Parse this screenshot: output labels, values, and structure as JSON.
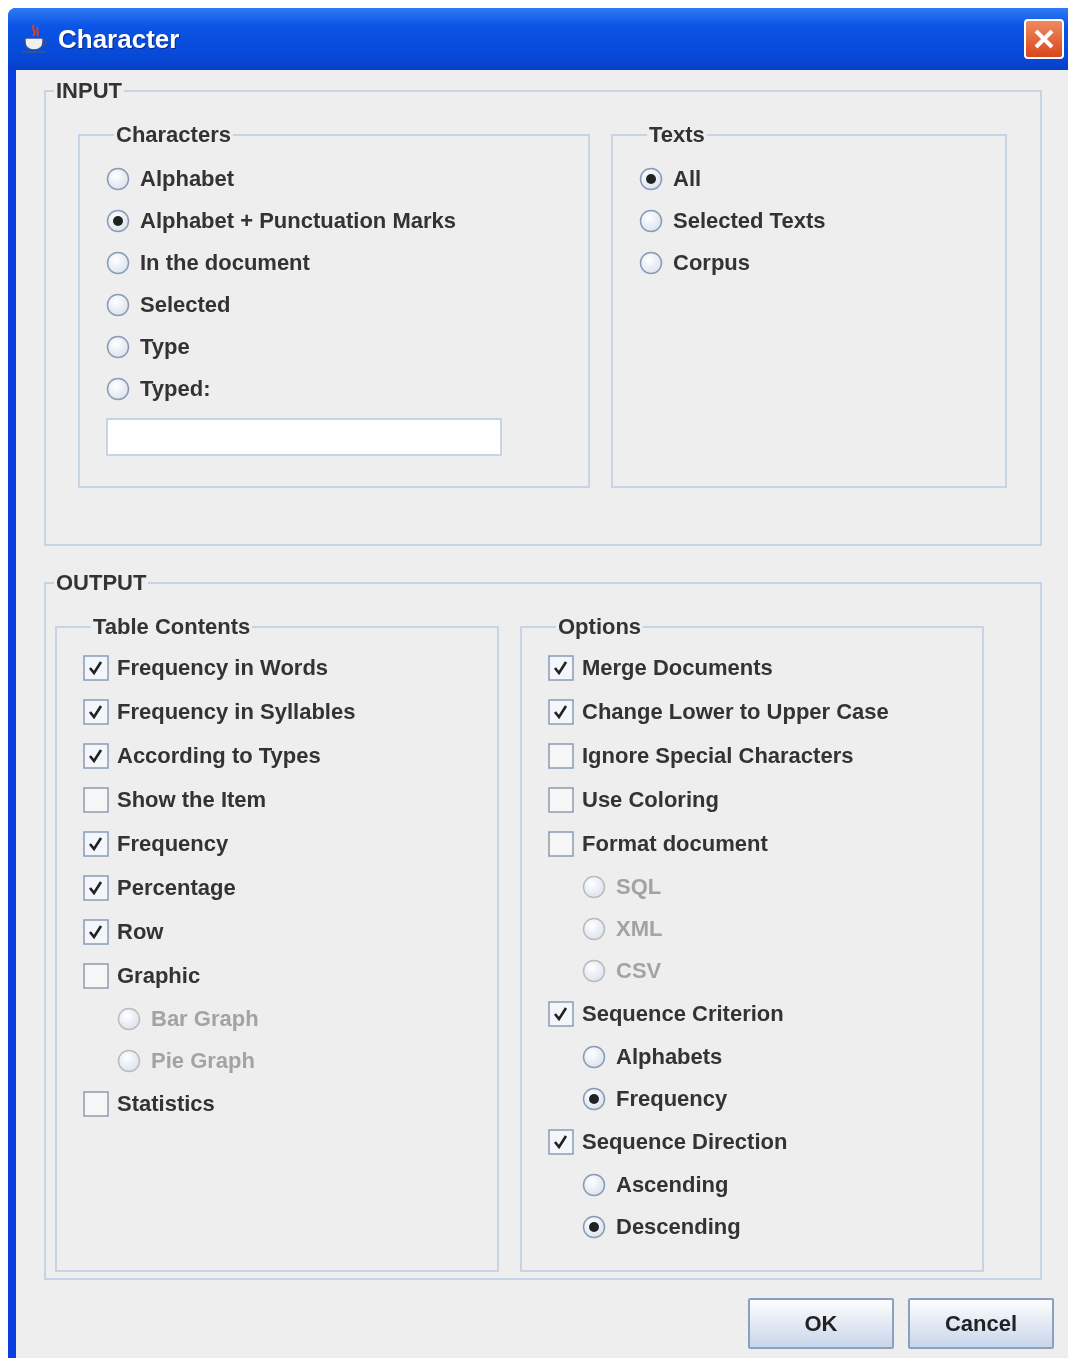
{
  "window": {
    "title": "Character"
  },
  "input": {
    "title": "INPUT",
    "characters": {
      "title": "Characters",
      "items": [
        {
          "kind": "radio",
          "label": "Alphabet",
          "selected": false
        },
        {
          "kind": "radio",
          "label": "Alphabet + Punctuation Marks",
          "selected": true
        },
        {
          "kind": "radio",
          "label": "In the document",
          "selected": false
        },
        {
          "kind": "radio",
          "label": "Selected",
          "selected": false
        },
        {
          "kind": "radio",
          "label": "Type",
          "selected": false
        },
        {
          "kind": "radio",
          "label": "Typed:",
          "selected": false
        },
        {
          "kind": "field"
        }
      ]
    },
    "texts": {
      "title": "Texts",
      "items": [
        {
          "kind": "radio",
          "label": "All",
          "selected": true
        },
        {
          "kind": "radio",
          "label": "Selected Texts",
          "selected": false
        },
        {
          "kind": "radio",
          "label": "Corpus",
          "selected": false
        }
      ]
    }
  },
  "output": {
    "title": "OUTPUT",
    "table_contents": {
      "title": "Table Contents",
      "items": [
        {
          "kind": "checkbox",
          "label": "Frequency in Words",
          "checked": true
        },
        {
          "kind": "checkbox",
          "label": "Frequency in Syllables",
          "checked": true
        },
        {
          "kind": "checkbox",
          "label": "According to Types",
          "checked": true
        },
        {
          "kind": "checkbox",
          "label": "Show the Item",
          "checked": false
        },
        {
          "kind": "checkbox",
          "label": "Frequency",
          "checked": true
        },
        {
          "kind": "checkbox",
          "label": "Percentage",
          "checked": true
        },
        {
          "kind": "checkbox",
          "label": "Row",
          "checked": true
        },
        {
          "kind": "checkbox",
          "label": "Graphic",
          "checked": false,
          "children": [
            {
              "kind": "radio",
              "label": "Bar Graph",
              "selected": false,
              "disabled": true
            },
            {
              "kind": "radio",
              "label": "Pie Graph",
              "selected": false,
              "disabled": true
            }
          ]
        },
        {
          "kind": "checkbox",
          "label": "Statistics",
          "checked": false
        }
      ]
    },
    "options": {
      "title": "Options",
      "items": [
        {
          "kind": "checkbox",
          "label": "Merge Documents",
          "checked": true
        },
        {
          "kind": "checkbox",
          "label": "Change Lower to Upper Case",
          "checked": true
        },
        {
          "kind": "checkbox",
          "label": "Ignore Special Characters",
          "checked": false
        },
        {
          "kind": "checkbox",
          "label": "Use Coloring",
          "checked": false
        },
        {
          "kind": "checkbox",
          "label": "Format document",
          "checked": false,
          "children": [
            {
              "kind": "radio",
              "label": "SQL",
              "selected": false,
              "disabled": true
            },
            {
              "kind": "radio",
              "label": "XML",
              "selected": false,
              "disabled": true
            },
            {
              "kind": "radio",
              "label": "CSV",
              "selected": false,
              "disabled": true
            }
          ]
        },
        {
          "kind": "checkbox",
          "label": "Sequence Criterion",
          "checked": true,
          "children": [
            {
              "kind": "radio",
              "label": "Alphabets",
              "selected": false,
              "disabled": false
            },
            {
              "kind": "radio",
              "label": "Frequency",
              "selected": true,
              "disabled": false
            }
          ]
        },
        {
          "kind": "checkbox",
          "label": "Sequence Direction",
          "checked": true,
          "children": [
            {
              "kind": "radio",
              "label": "Ascending",
              "selected": false,
              "disabled": false
            },
            {
              "kind": "radio",
              "label": "Descending",
              "selected": true,
              "disabled": false
            }
          ]
        }
      ]
    }
  },
  "buttons": [
    {
      "label": "OK"
    },
    {
      "label": "Cancel"
    }
  ]
}
